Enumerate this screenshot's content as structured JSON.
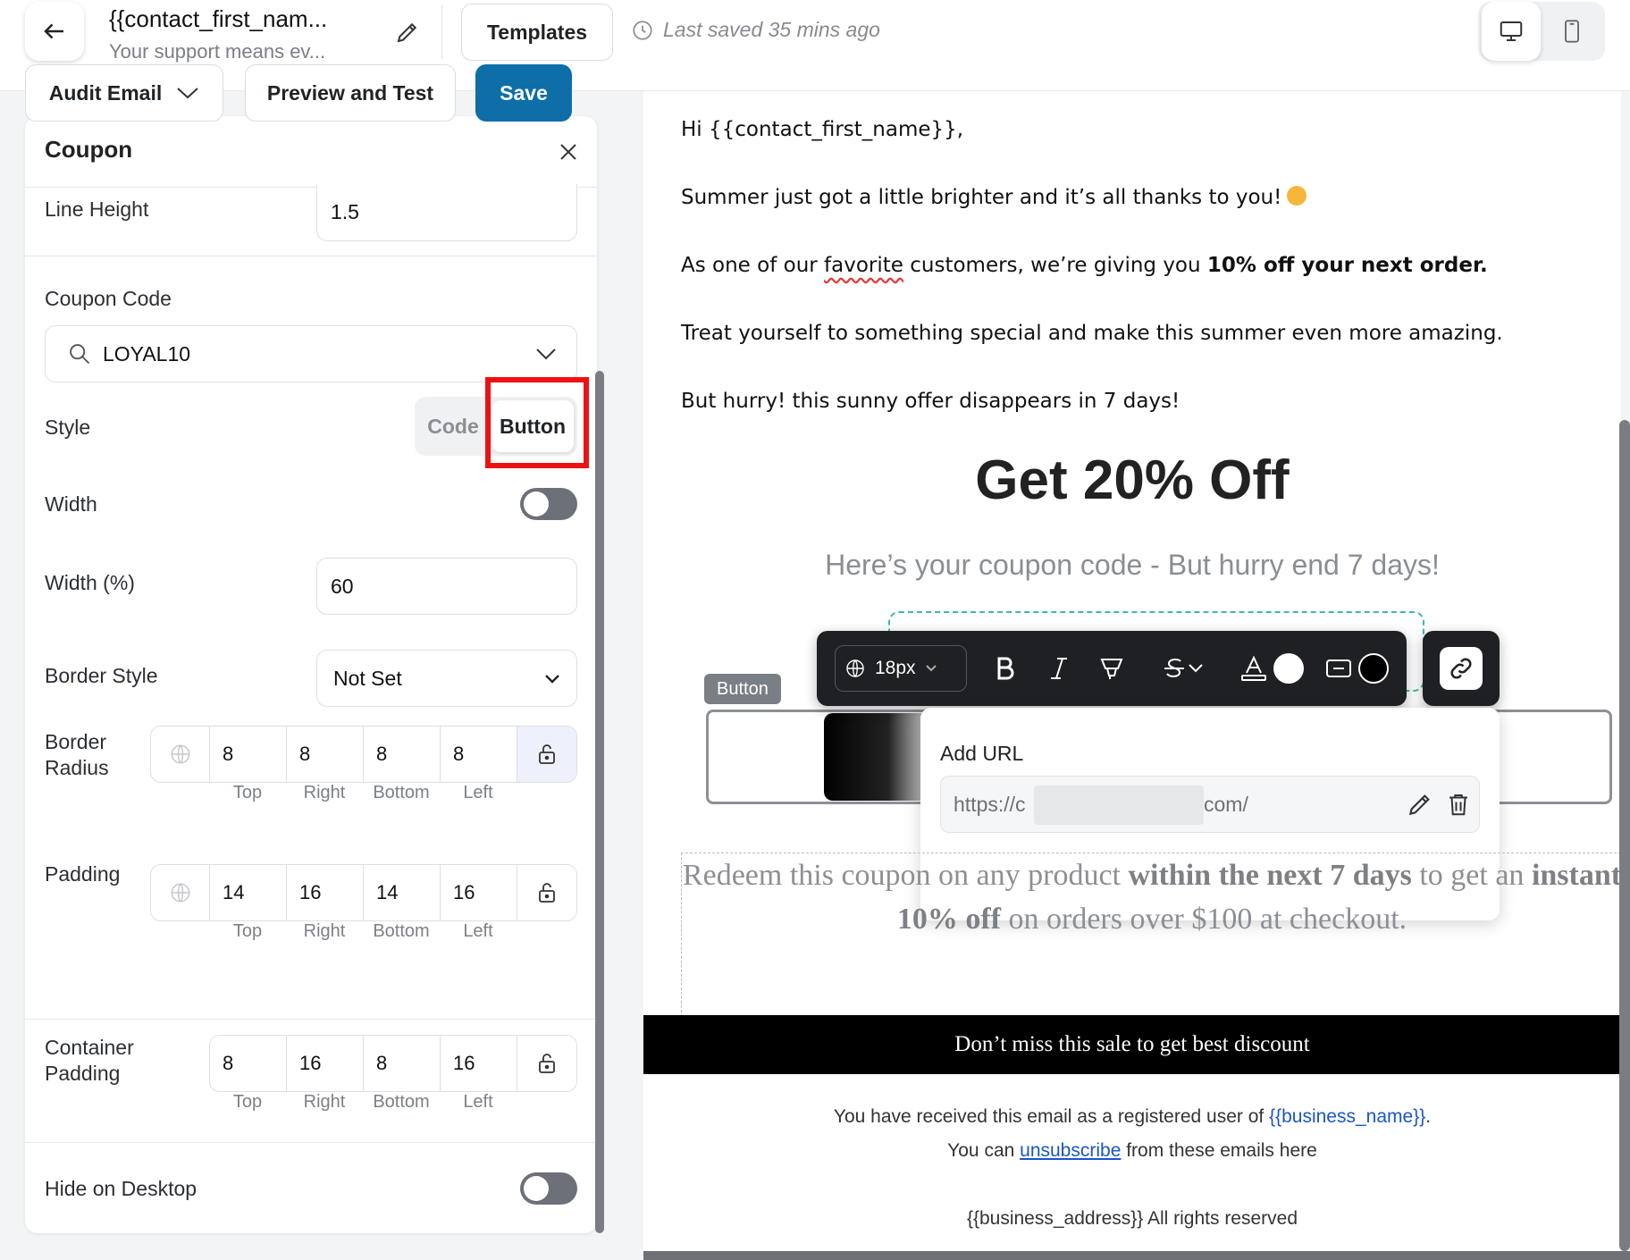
{
  "header": {
    "title": "{{contact_first_nam...",
    "subtitle": "Your support means ev...",
    "templates_label": "Templates",
    "saved_status": "Last saved 35 mins ago",
    "audit_label": "Audit Email",
    "preview_label": "Preview and Test",
    "save_label": "Save",
    "device_options": [
      "desktop-icon",
      "mobile-icon"
    ],
    "active_device": "desktop"
  },
  "panel": {
    "title": "Coupon",
    "line_height": {
      "label": "Line Height",
      "value": "1.5"
    },
    "coupon_code": {
      "label": "Coupon Code",
      "value": "LOYAL10"
    },
    "style": {
      "label": "Style",
      "options": [
        "Code",
        "Button"
      ],
      "selected": "Button"
    },
    "width_toggle": {
      "label": "Width",
      "on": false
    },
    "width_percent": {
      "label": "Width (%)",
      "value": "60"
    },
    "border_style": {
      "label": "Border Style",
      "value": "Not Set"
    },
    "border_radius": {
      "label_line1": "Border",
      "label_line2": "Radius",
      "values": [
        "8",
        "8",
        "8",
        "8"
      ]
    },
    "padding": {
      "label": "Padding",
      "values": [
        "14",
        "16",
        "14",
        "16"
      ]
    },
    "container_padding": {
      "label_line1": "Container",
      "label_line2": "Padding",
      "values": [
        "8",
        "16",
        "8",
        "16"
      ]
    },
    "side_labels": [
      "Top",
      "Right",
      "Bottom",
      "Left"
    ],
    "hide_desktop": {
      "label": "Hide on Desktop",
      "on": false
    }
  },
  "email": {
    "greeting": "Hi {{contact_first_name}},",
    "line1": "Summer just got a little brighter and it’s all thanks to you!",
    "line2_pre": "As one of our ",
    "line2_spell": "favorite",
    "line2_mid": " customers, we’re giving you ",
    "line2_bold": "10% off your next order.",
    "line3": "Treat yourself to something special and make this summer even more amazing.",
    "line4": "But hurry! this sunny offer disappears in 7 days!",
    "headline": "Get 20% Off",
    "subheadline": "Here’s your coupon code - But hurry end 7 days!",
    "button_tag": "Button",
    "redeem": {
      "a": "Redeem this coupon on any product ",
      "b": "within the next 7 days",
      "c": " to get an ",
      "d": "instant 10% off",
      "e": " on orders over $100 at checkout."
    },
    "banner": "Don’t miss this sale to get best discount",
    "footer_1_pre": "You have received this email as a registered user of ",
    "footer_1_link": "{{business_name}}",
    "footer_1_post": ".",
    "footer_2_pre": "You can ",
    "footer_2_link": "unsubscribe",
    "footer_2_post": " from these emails here",
    "footer_3": "{{business_address}}  All rights reserved"
  },
  "toolbar": {
    "font_size": "18px",
    "text_color": "#ffffff",
    "bg_color": "#000000",
    "url_popup_title": "Add URL",
    "url_prefix": "https://c",
    "url_suffix": "com/"
  },
  "colors": {
    "primary": "#0d6ea8",
    "highlight": "#ee1111",
    "link": "#1a55c9"
  }
}
